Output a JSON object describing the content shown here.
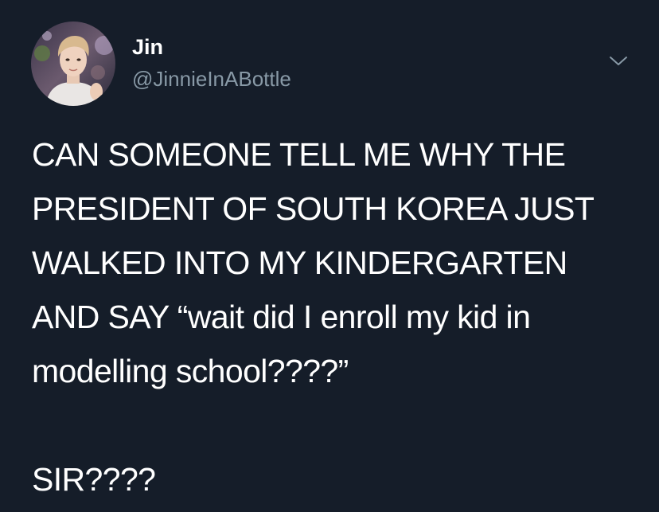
{
  "colors": {
    "background": "#151d29",
    "primary_text": "#ffffff",
    "secondary_text": "#8899a6"
  },
  "author": {
    "display_name": "Jin",
    "handle": "@JinnieInABottle",
    "avatar_icon": "profile-photo"
  },
  "menu": {
    "icon": "chevron-down-icon"
  },
  "tweet": {
    "lines": [
      "CAN SOMEONE TELL ME WHY THE",
      "PRESIDENT OF SOUTH KOREA JUST",
      "WALKED INTO MY KINDERGARTEN",
      "AND SAY “wait did I enroll my kid in",
      "modelling school????”"
    ],
    "closing_line": "SIR????"
  }
}
